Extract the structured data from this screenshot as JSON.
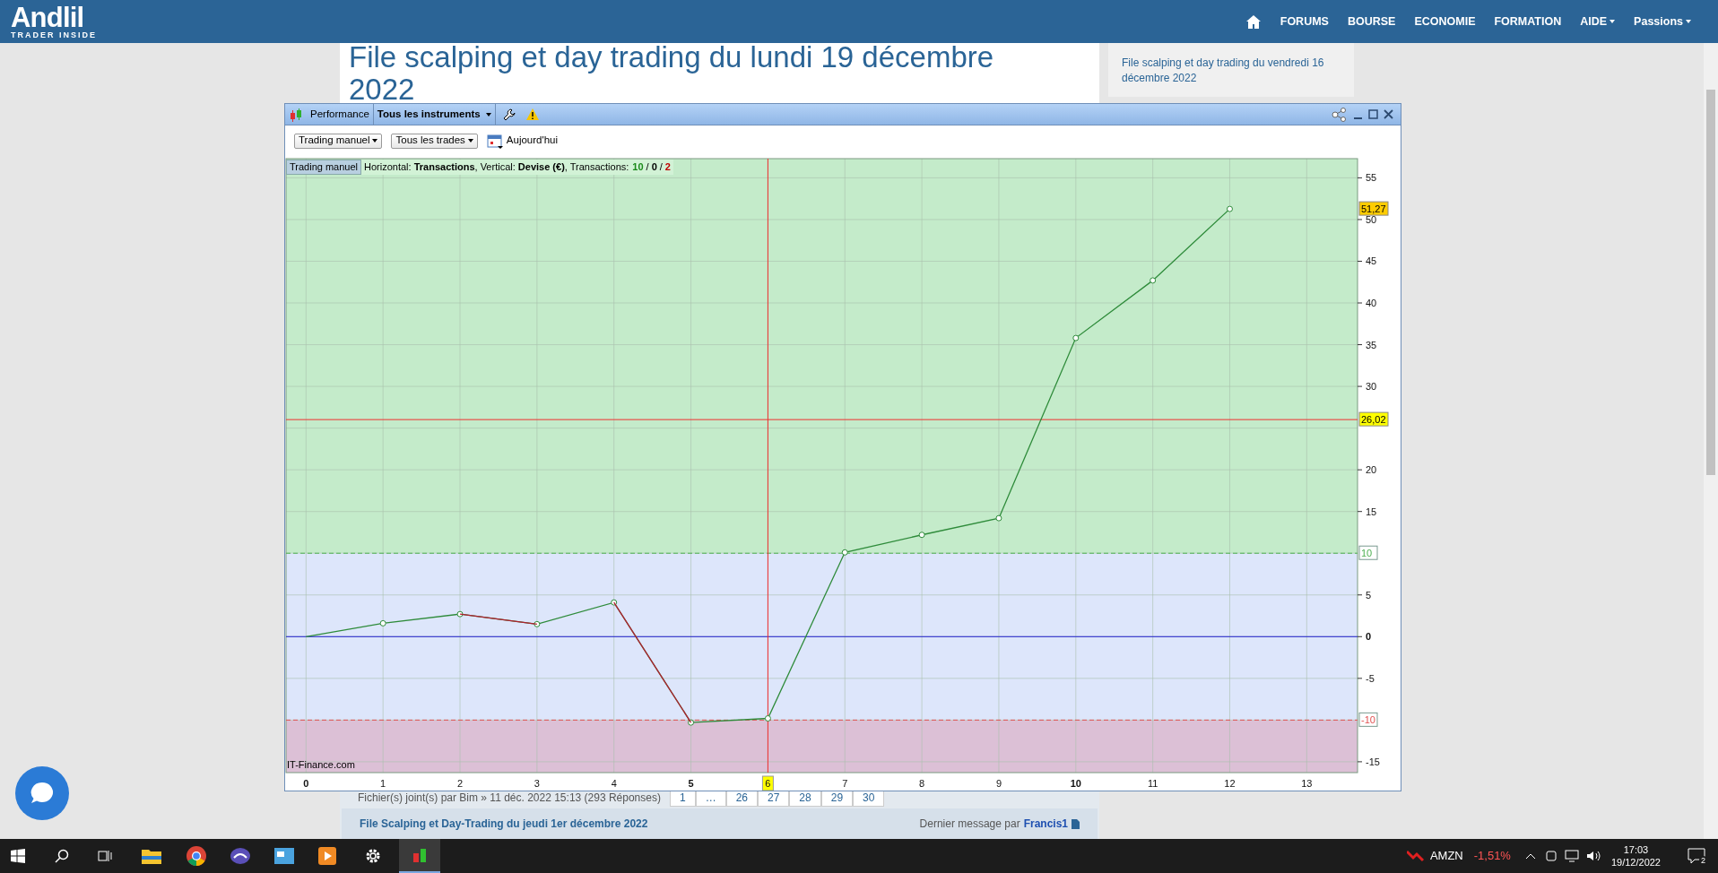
{
  "nav": {
    "logo": "Andlil",
    "tagline": "TRADER INSIDE",
    "items": [
      {
        "label": "FORUMS",
        "dropdown": false
      },
      {
        "label": "BOURSE",
        "dropdown": false
      },
      {
        "label": "ECONOMIE",
        "dropdown": false
      },
      {
        "label": "FORMATION",
        "dropdown": false
      },
      {
        "label": "AIDE",
        "dropdown": true
      },
      {
        "label": "Passions",
        "dropdown": true
      }
    ]
  },
  "page": {
    "title": "File scalping et day trading du lundi 19 décembre 2022",
    "sidebar_link": "File scalping et day trading du vendredi 16 décembre 2022",
    "topic_meta": "Fichier(s) joint(s) par Bim » 11 déc. 2022 15:13 (293 Réponses)",
    "pages": [
      "1",
      "…",
      "26",
      "27",
      "28",
      "29",
      "30"
    ],
    "topic": {
      "title": "File Scalping et Day-Trading du jeudi 1er décembre 2022",
      "last_label": "Dernier message par",
      "last_author": "Francis1"
    }
  },
  "window": {
    "title_tab": "Performance",
    "instrument_menu": "Tous les instruments",
    "filters": [
      "Trading manuel",
      "Tous les trades"
    ],
    "date_label": "Aujourd'hui",
    "chart_tab": "Trading manuel",
    "legend": "Horizontal: **Transactions**, Vertical: **Devise (€)**, Transactions:",
    "counts": [
      {
        "text": "10",
        "color": "#1a8a1a"
      },
      {
        "text": "0",
        "color": "#000000"
      },
      {
        "text": "2",
        "color": "#c00000"
      }
    ],
    "count_separator": "/",
    "source": "IT-Finance.com",
    "chart_data": {
      "type": "line",
      "x": [
        0,
        1,
        2,
        3,
        4,
        5,
        6,
        7,
        8,
        9,
        10,
        11,
        12
      ],
      "series": [
        {
          "color": "#2e8b3a",
          "marker": "o",
          "values": [
            0,
            1.6,
            2.7,
            1.5,
            4.1,
            -10.3,
            -9.8,
            10.1,
            12.2,
            14.2,
            35.8,
            42.7,
            51.27
          ]
        },
        {
          "color": "#b02030",
          "values": [
            null,
            null,
            2.7,
            1.5,
            null,
            null,
            null,
            null,
            null,
            null,
            null,
            null,
            null
          ]
        },
        {
          "color": "#b02030",
          "values": [
            null,
            null,
            null,
            null,
            4.1,
            -10.3,
            null,
            null,
            null,
            null,
            null,
            null,
            null
          ]
        }
      ],
      "xlim": [
        -0.26,
        13.66
      ],
      "ylim": [
        -16.3,
        57.3
      ],
      "xticks": [
        0,
        1,
        2,
        3,
        4,
        5,
        6,
        7,
        8,
        9,
        10,
        11,
        12,
        13
      ],
      "yticks": [
        55,
        50,
        45,
        40,
        35,
        30,
        20,
        15,
        5,
        0,
        -5,
        -15
      ],
      "grid": true,
      "bands": [
        {
          "axis": "y",
          "from": 10,
          "to": 57.3,
          "color": "#c4ebca"
        },
        {
          "axis": "y",
          "from": -10,
          "to": 10,
          "color": "#dde6fb"
        },
        {
          "axis": "y",
          "from": -16.3,
          "to": -10,
          "color": "#dcc0d6"
        }
      ],
      "ref_lines": [
        {
          "axis": "y",
          "value": 10,
          "color": "#4caf50",
          "label": "10"
        },
        {
          "axis": "y",
          "value": -10,
          "color": "#e05050",
          "label": "-10"
        },
        {
          "axis": "y",
          "value": 0,
          "color": "#2020d0"
        },
        {
          "axis": "y",
          "value": 26.02,
          "color": "#f03030",
          "label": "26,02"
        },
        {
          "axis": "x",
          "value": 6,
          "color": "#f03030"
        }
      ],
      "annotations": [
        "51,27"
      ]
    }
  },
  "taskbar": {
    "ticker": "AMZN",
    "change": "-1,51%",
    "time": "17:03",
    "date": "19/12/2022",
    "notifications": "2"
  }
}
